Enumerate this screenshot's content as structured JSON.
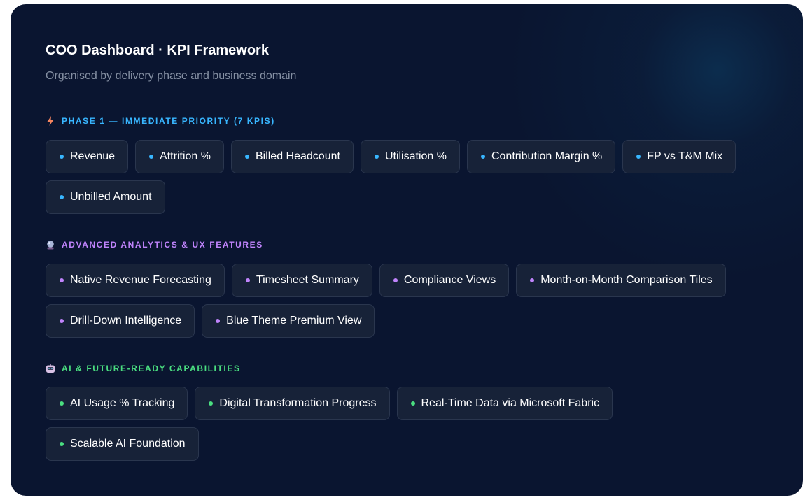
{
  "header": {
    "title": "COO Dashboard · KPI Framework",
    "subtitle": "Organised by delivery phase and business domain"
  },
  "sections": [
    {
      "icon": "lightning-icon",
      "label": "PHASE 1 — IMMEDIATE PRIORITY (7 KPIS)",
      "accent": "#38b6ff",
      "items": [
        "Revenue",
        "Attrition %",
        "Billed Headcount",
        "Utilisation %",
        "Contribution Margin %",
        "FP vs T&M Mix",
        "Unbilled Amount"
      ]
    },
    {
      "icon": "crystal-ball-icon",
      "label": "ADVANCED ANALYTICS & UX FEATURES",
      "accent": "#c084fc",
      "items": [
        "Native Revenue Forecasting",
        "Timesheet Summary",
        "Compliance Views",
        "Month-on-Month Comparison Tiles",
        "Drill-Down Intelligence",
        "Blue Theme Premium View"
      ]
    },
    {
      "icon": "robot-icon",
      "label": "AI & FUTURE-READY CAPABILITIES",
      "accent": "#4ade80",
      "items": [
        "AI Usage % Tracking",
        "Digital Transformation Progress",
        "Real-Time Data via Microsoft Fabric",
        "Scalable AI Foundation"
      ]
    }
  ]
}
